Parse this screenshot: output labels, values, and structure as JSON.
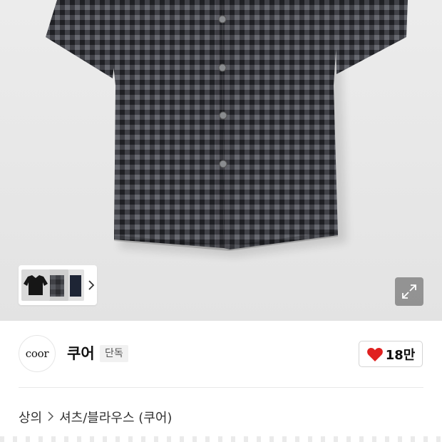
{
  "product_image": {
    "shirt_colors": {
      "dark": "#2e2f33",
      "light": "#6d6f76",
      "button": "#8a8c8f"
    }
  },
  "thumbnails": {
    "items": [
      "black shirt",
      "grey check shirt",
      "navy shirt"
    ]
  },
  "brand": {
    "logo_text": "coor",
    "name": "쿠어",
    "badge": "단독"
  },
  "like": {
    "count": "18만",
    "icon_color": "#e0201f"
  },
  "breadcrumb": {
    "items": [
      "상의",
      "셔츠/블라우스 (쿠어)"
    ]
  }
}
